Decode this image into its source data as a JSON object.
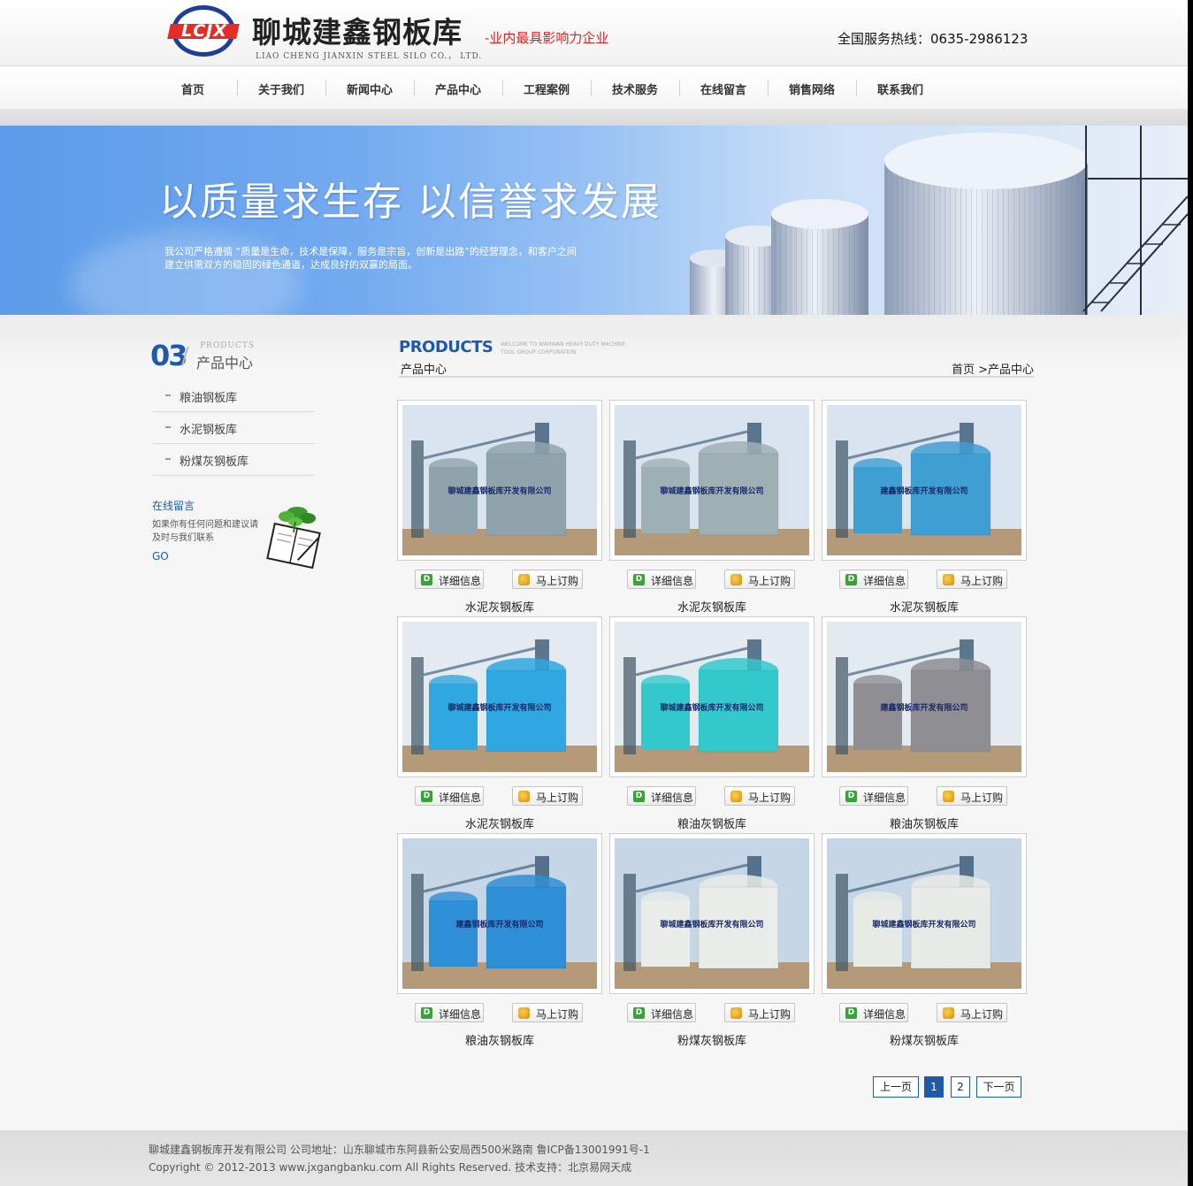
{
  "header": {
    "logo_text": "LCJX",
    "company_name": "聊城建鑫钢板库",
    "slogan": "-业内最具影响力企业",
    "company_name_en": "LIAO CHENG JIANXIN STEEL SILO CO.， LTD.",
    "hotline": "全国服务热线：0635-2986123"
  },
  "nav": {
    "items": [
      {
        "label": "首页"
      },
      {
        "label": "关于我们"
      },
      {
        "label": "新闻中心"
      },
      {
        "label": "产品中心"
      },
      {
        "label": "工程案例"
      },
      {
        "label": "技术服务"
      },
      {
        "label": "在线留言"
      },
      {
        "label": "销售网络"
      },
      {
        "label": "联系我们"
      }
    ]
  },
  "banner": {
    "title": "以质量求生存  以信誉求发展",
    "description": "我公司严格遵循 “质量是生命，技术是保障，服务是宗旨，创新是出路”的经营理念，和客户之间建立供需双方的稳固的绿色通道，达成良好的双赢的局面。"
  },
  "sidebar": {
    "number": "03",
    "title_en": "PRODUCTS",
    "title_cn": "产品中心",
    "categories": [
      {
        "label": "粮油钢板库"
      },
      {
        "label": "水泥钢板库"
      },
      {
        "label": "粉煤灰钢板库"
      }
    ],
    "message": {
      "title": "在线留言",
      "text": "如果你有任何问题和建议请及时与我们联系",
      "go": "GO"
    }
  },
  "main": {
    "heading_en": "PRODUCTS",
    "heading_sub": "WELCOME TO WANWAN HEAVY DUTY MACHINE TOOL GROUP CORPORATION",
    "section_title": "产品中心",
    "breadcrumb": "首页 >产品中心",
    "detail_label": "详细信息",
    "order_label": "马上订购",
    "products": [
      {
        "name": "水泥灰钢板库",
        "tank_color": "#8fa3ad",
        "sign": "聊城建鑫钢板库开发有限公司"
      },
      {
        "name": "水泥灰钢板库",
        "tank_color": "#9fb0b5",
        "sign": "聊城建鑫钢板库开发有限公司"
      },
      {
        "name": "水泥灰钢板库",
        "tank_color": "#3f9fd2",
        "sign": "建鑫钢板库开发有限公司"
      },
      {
        "name": "水泥灰钢板库",
        "tank_color": "#2fa7e0",
        "sign": "聊城建鑫钢板库开发有限公司"
      },
      {
        "name": "粮油灰钢板库",
        "tank_color": "#33c9cc",
        "sign": "聊城建鑫钢板库开发有限公司"
      },
      {
        "name": "粮油灰钢板库",
        "tank_color": "#8e8e93",
        "sign": "建鑫钢板库开发有限公司"
      },
      {
        "name": "粮油灰钢板库",
        "tank_color": "#2f8fd6",
        "sign": "建鑫钢板库开发有限公司"
      },
      {
        "name": "粉煤灰钢板库",
        "tank_color": "#e9ece8",
        "sign": "聊城建鑫钢板库开发有限公司"
      },
      {
        "name": "粉煤灰钢板库",
        "tank_color": "#e7ebe6",
        "sign": "聊城建鑫钢板库开发有限公司"
      }
    ]
  },
  "pagination": {
    "prev": "上一页",
    "pages": [
      "1",
      "2"
    ],
    "current": "1",
    "next": "下一页"
  },
  "footer": {
    "line1": "聊城建鑫钢板库开发有限公司 公司地址：山东聊城市东阿县新公安局西500米路南 鲁ICP备13001991号-1",
    "line2": "Copyright © 2012-2013 www.jxgangbanku.com All Rights Reserved. 技术支持：北京易网天成"
  },
  "colors": {
    "accent": "#1e5aa8",
    "slogan_red": "#e02020",
    "banner_blue": "#5c9be8"
  }
}
